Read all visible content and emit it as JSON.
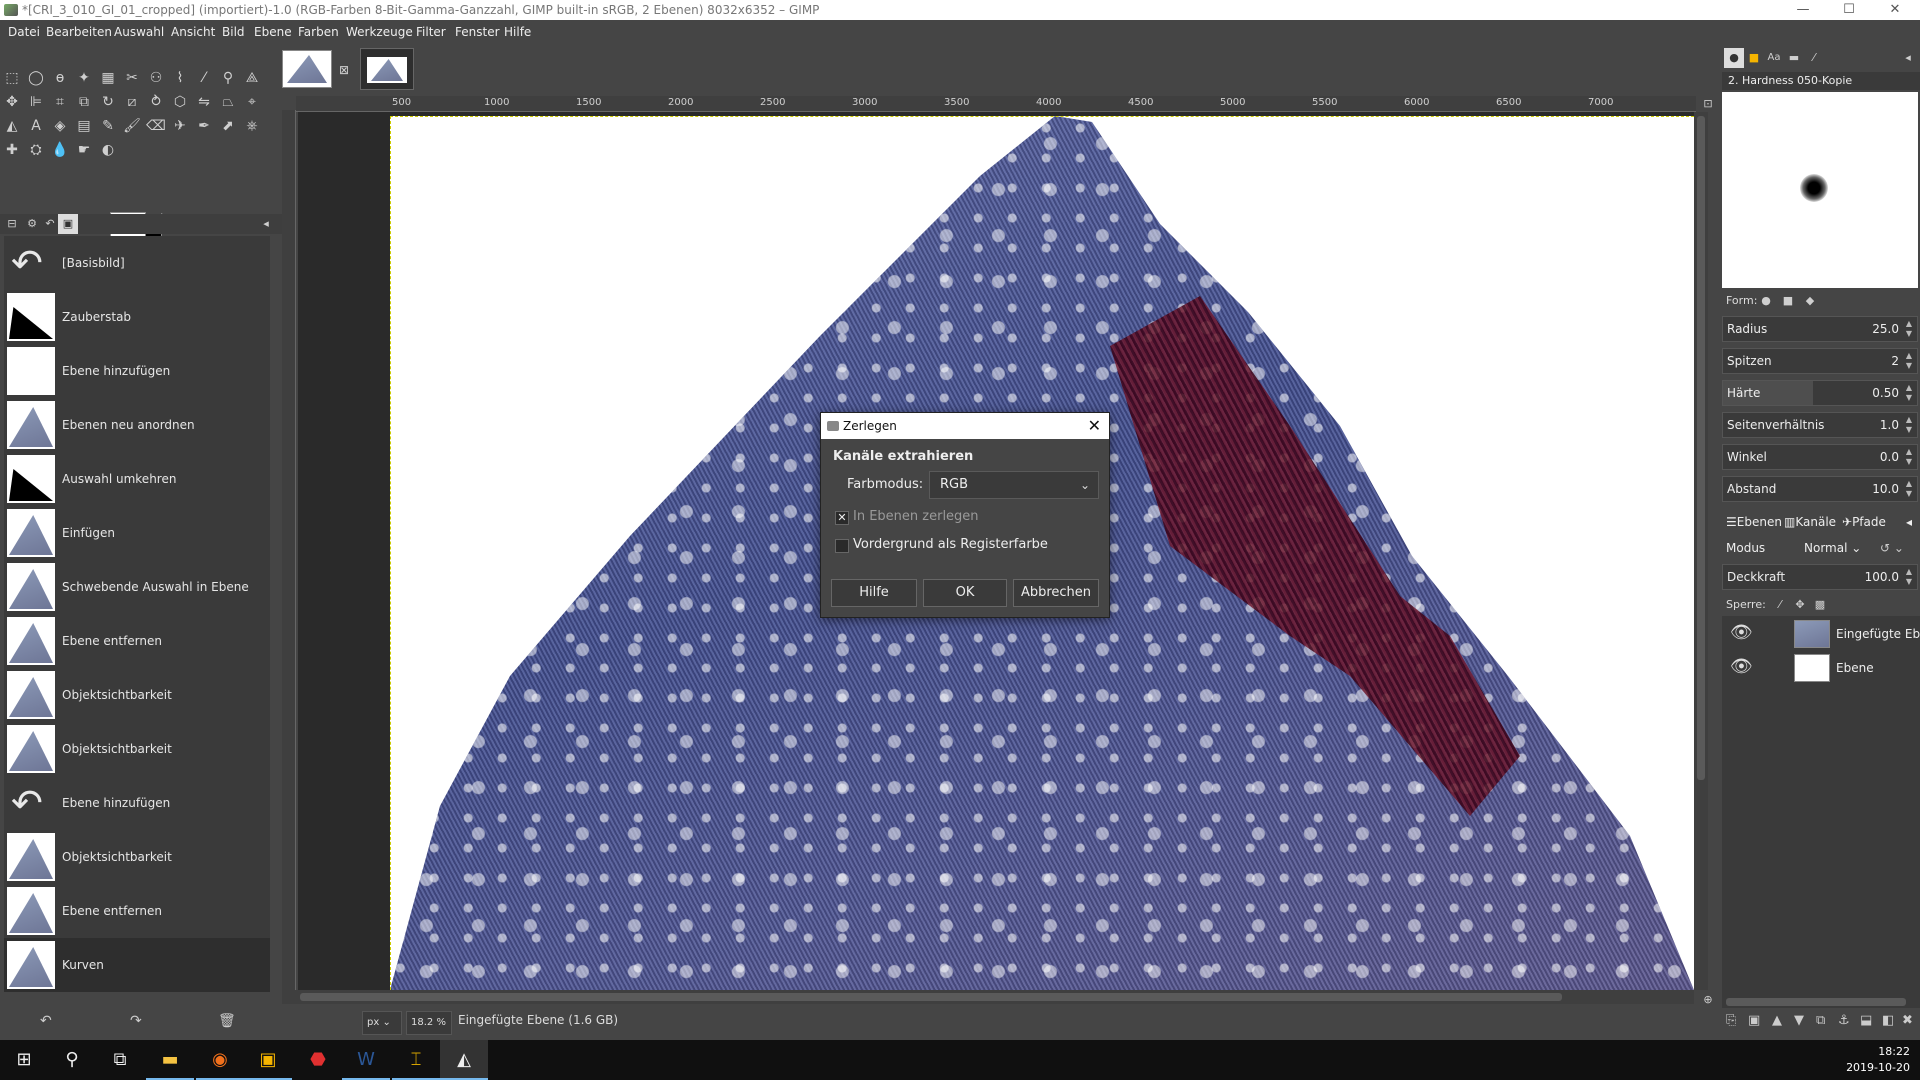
{
  "window": {
    "title": "*[CRI_3_010_GI_01_cropped] (importiert)-1.0 (RGB-Farben 8-Bit-Gamma-Ganzzahl, GIMP built-in sRGB, 2 Ebenen) 8032x6352 – GIMP",
    "minimize": "—",
    "maximize": "☐",
    "close": "✕"
  },
  "menu": [
    "Datei",
    "Bearbeiten",
    "Auswahl",
    "Ansicht",
    "Bild",
    "Ebene",
    "Farben",
    "Werkzeuge",
    "Filter",
    "Fenster",
    "Hilfe"
  ],
  "history": {
    "items": [
      {
        "label": "[Basisbild]",
        "thumb": "undo"
      },
      {
        "label": "Zauberstab",
        "thumb": "dark"
      },
      {
        "label": "Ebene hinzufügen",
        "thumb": "blank"
      },
      {
        "label": "Ebenen neu anordnen",
        "thumb": "tri"
      },
      {
        "label": "Auswahl umkehren",
        "thumb": "dark"
      },
      {
        "label": "Einfügen",
        "thumb": "tri"
      },
      {
        "label": "Schwebende Auswahl in Ebene",
        "thumb": "tri"
      },
      {
        "label": "Ebene entfernen",
        "thumb": "tri"
      },
      {
        "label": "Objektsichtbarkeit",
        "thumb": "tri"
      },
      {
        "label": "Objektsichtbarkeit",
        "thumb": "tri"
      },
      {
        "label": "Ebene hinzufügen",
        "thumb": "undo"
      },
      {
        "label": "Objektsichtbarkeit",
        "thumb": "tri"
      },
      {
        "label": "Ebene entfernen",
        "thumb": "tri"
      },
      {
        "label": "Kurven",
        "thumb": "tri"
      }
    ],
    "undo_icon": "↶",
    "redo_icon": "↷",
    "clear_icon": "🗑"
  },
  "ruler": {
    "h_labels": [
      "500",
      "1000",
      "1500",
      "2000",
      "2500",
      "3000",
      "3500",
      "4000",
      "4500",
      "5000",
      "5500",
      "6000",
      "6500",
      "7000"
    ]
  },
  "status": {
    "unit": "px",
    "zoom": "18.2 %",
    "layer_info": "Eingefügte Ebene (1.6 GB)"
  },
  "brush": {
    "name": "2. Hardness 050-Kopie",
    "form_label": "Form:"
  },
  "brush_props": [
    {
      "label": "Radius",
      "value": "25.0"
    },
    {
      "label": "Spitzen",
      "value": "2"
    },
    {
      "label": "Härte",
      "value": "0.50"
    },
    {
      "label": "Seitenverhältnis",
      "value": "1.0"
    },
    {
      "label": "Winkel",
      "value": "0.0"
    },
    {
      "label": "Abstand",
      "value": "10.0"
    }
  ],
  "layers_panel": {
    "tabs": [
      "Ebenen",
      "Kanäle",
      "Pfade"
    ],
    "mode_label": "Modus",
    "mode_value": "Normal",
    "opacity_label": "Deckkraft",
    "opacity_value": "100.0",
    "lock_label": "Sperre:",
    "layers": [
      {
        "name": "Eingefügte Ebe",
        "thumb": "sample"
      },
      {
        "name": "Ebene",
        "thumb": "white"
      }
    ]
  },
  "dialog": {
    "title": "Zerlegen",
    "close": "✕",
    "heading": "Kanäle extrahieren",
    "model_label": "Farbmodus:",
    "model_value": "RGB",
    "check1": "In Ebenen zerlegen",
    "check2": "Vordergrund als Registerfarbe",
    "btn_help": "Hilfe",
    "btn_ok": "OK",
    "btn_cancel": "Abbrechen"
  },
  "taskbar": {
    "time": "18:22",
    "date": "2019-10-20"
  }
}
